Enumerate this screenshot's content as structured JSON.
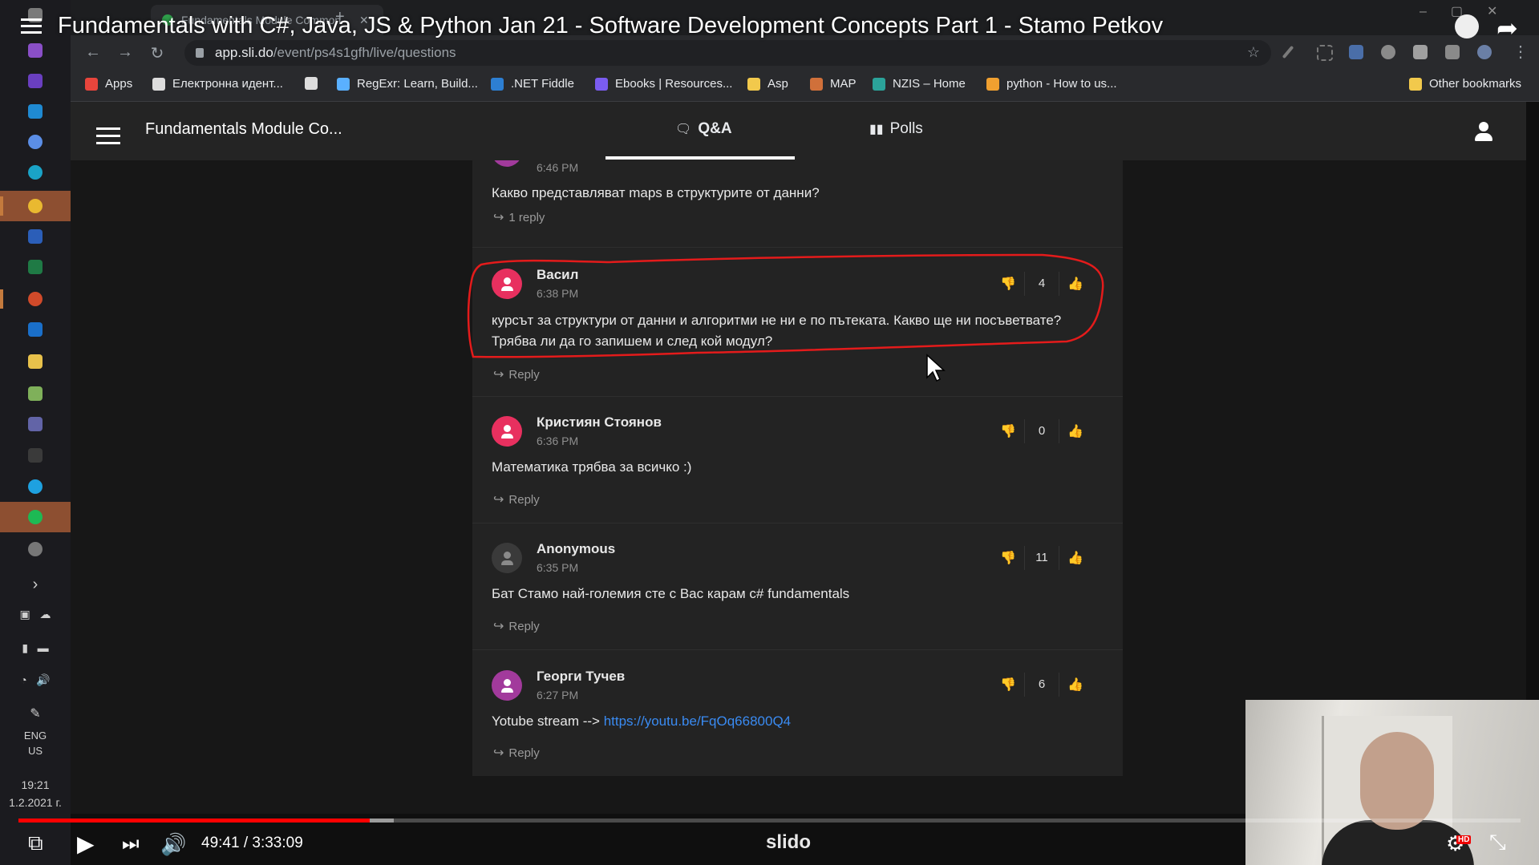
{
  "browser": {
    "tab_title": "Fundamentals Module Common",
    "url_host": "app.sli.do",
    "url_path": "/event/ps4s1gfh/live/questions",
    "bookmarks": [
      {
        "label": "Apps",
        "color": "#e8453c"
      },
      {
        "label": "Електронна идент...",
        "color": "#dddddd"
      },
      {
        "label": "",
        "color": "#dddddd"
      },
      {
        "label": "RegExr: Learn, Build...",
        "color": "#5ab0ff"
      },
      {
        "label": ".NET Fiddle",
        "color": "#2d7fd3"
      },
      {
        "label": "Ebooks | Resources...",
        "color": "#7a5cf0"
      },
      {
        "label": "Asp",
        "color": "#f2c94c"
      },
      {
        "label": "MAP",
        "color": "#d0703a"
      },
      {
        "label": "NZIS – Home",
        "color": "#2ba39a"
      },
      {
        "label": "python - How to us...",
        "color": "#f0a030"
      }
    ],
    "other_bookmarks": "Other bookmarks"
  },
  "video": {
    "title": "Fundamentals with C#, Java, JS & Python Jan 21 - Software Development Concepts Part 1 - Stamo Petkov",
    "time": "49:41 / 3:33:09",
    "progress_fraction": 0.234,
    "buffered_fraction": 0.25,
    "brand": "slido",
    "hd_badge": "HD"
  },
  "app": {
    "event_title": "Fundamentals Module Co...",
    "tabs": [
      {
        "label": "Q&A",
        "icon": "qa-icon"
      },
      {
        "label": "Polls",
        "icon": "polls-icon"
      }
    ],
    "active_tab": "Q&A"
  },
  "questions": [
    {
      "author": "",
      "time": "6:46 PM",
      "text": "Какво представляват maps в структурите от данни?",
      "votes": "",
      "reply": "1 reply",
      "avatar": "purple"
    },
    {
      "author": "Васил",
      "time": "6:38 PM",
      "text": "курсът за структури от данни и алгоритми не ни е по пътеката. Какво ще ни посъветвате? Трябва ли да го запишем и след кой модул?",
      "votes": "4",
      "reply": "Reply",
      "avatar": "pink",
      "highlighted": true
    },
    {
      "author": "Кристиян Стоянов",
      "time": "6:36 PM",
      "text": "Математика трябва за всичко :)",
      "votes": "0",
      "reply": "Reply",
      "avatar": "pink"
    },
    {
      "author": "Anonymous",
      "time": "6:35 PM",
      "text": "Бат Стамо най-големия сте с Вас карам c# fundamentals",
      "votes": "11",
      "reply": "Reply",
      "avatar": "anon"
    },
    {
      "author": "Георги Тучев",
      "time": "6:27 PM",
      "text_prefix": "Yotube stream --> ",
      "link": "https://youtu.be/FqOq66800Q4",
      "votes": "6",
      "reply": "Reply",
      "avatar": "purple"
    }
  ],
  "system": {
    "language": "ENG",
    "region": "US",
    "time": "19:21",
    "date": "1.2.2021 г."
  },
  "colors": {
    "accent_red": "#ff0000",
    "slido_green": "#2e9e4a",
    "avatar_pink": "#e8305f",
    "link_blue": "#3a8bf2"
  }
}
